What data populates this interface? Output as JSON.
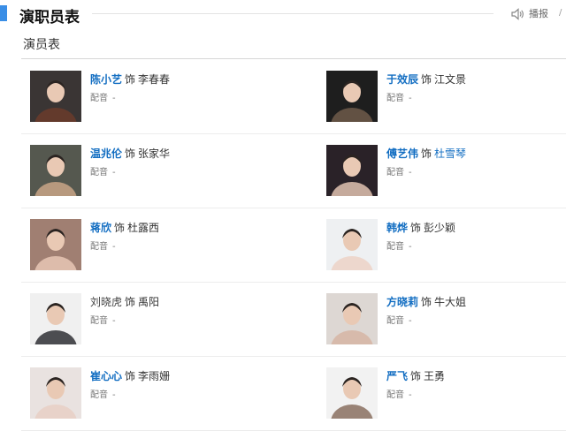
{
  "section": {
    "title": "演职员表",
    "play_label": "播报",
    "edge_mark": "/",
    "accent_color": "#3a8ee6"
  },
  "subtitle": "演员表",
  "cast": [
    {
      "actor": "陈小艺",
      "role_word": "饰",
      "role": "李春春",
      "dub_label": "配音",
      "dub_value": "-",
      "actor_link": true,
      "role_link": false
    },
    {
      "actor": "于效辰",
      "role_word": "饰",
      "role": "江文景",
      "dub_label": "配音",
      "dub_value": "-",
      "actor_link": true,
      "role_link": false
    },
    {
      "actor": "温兆伦",
      "role_word": "饰",
      "role": "张家华",
      "dub_label": "配音",
      "dub_value": "-",
      "actor_link": true,
      "role_link": false
    },
    {
      "actor": "傅艺伟",
      "role_word": "饰",
      "role": "杜雪琴",
      "dub_label": "配音",
      "dub_value": "-",
      "actor_link": true,
      "role_link": true
    },
    {
      "actor": "蒋欣",
      "role_word": "饰",
      "role": "杜露西",
      "dub_label": "配音",
      "dub_value": "-",
      "actor_link": true,
      "role_link": false
    },
    {
      "actor": "韩烨",
      "role_word": "饰",
      "role": "彭少颖",
      "dub_label": "配音",
      "dub_value": "-",
      "actor_link": true,
      "role_link": false
    },
    {
      "actor": "刘晓虎",
      "role_word": "饰",
      "role": "禹阳",
      "dub_label": "配音",
      "dub_value": "-",
      "actor_link": false,
      "role_link": false
    },
    {
      "actor": "方晓莉",
      "role_word": "饰",
      "role": "牛大姐",
      "dub_label": "配音",
      "dub_value": "-",
      "actor_link": true,
      "role_link": false
    },
    {
      "actor": "崔心心",
      "role_word": "饰",
      "role": "李雨姗",
      "dub_label": "配音",
      "dub_value": "-",
      "actor_link": true,
      "role_link": false
    },
    {
      "actor": "严飞",
      "role_word": "饰",
      "role": "王勇",
      "dub_label": "配音",
      "dub_value": "-",
      "actor_link": true,
      "role_link": false
    }
  ],
  "colors": {
    "link": "#136ec2",
    "photo_backgrounds": [
      "#3a3534",
      "#1e1e1e",
      "#55584f",
      "#2a2228",
      "#a07f72",
      "#eef0f2",
      "#f0f0f0",
      "#ddd7d3",
      "#e9e2e0",
      "#f2f2f2"
    ],
    "photo_subjects": [
      "#6b3b2b",
      "#6f5a4a",
      "#c9a486",
      "#e0c2b0",
      "#e7c7b5",
      "#ecd2c7",
      "#2f3035",
      "#d6b5a3",
      "#e8cfc4",
      "#8a7060"
    ]
  }
}
